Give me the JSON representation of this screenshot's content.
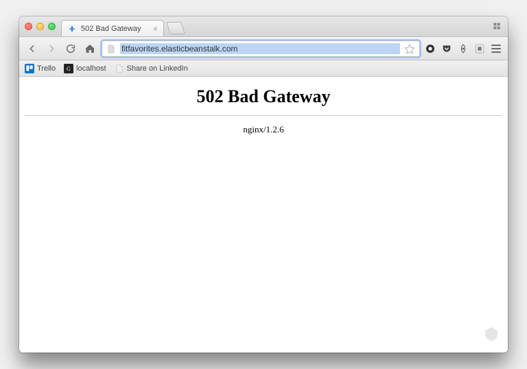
{
  "tab": {
    "title": "502 Bad Gateway"
  },
  "address": {
    "url": "fitfavorites.elasticbeanstalk.com"
  },
  "bookmarks": [
    {
      "label": "Trello"
    },
    {
      "label": "localhost"
    },
    {
      "label": "Share on LinkedIn"
    }
  ],
  "page": {
    "heading": "502 Bad Gateway",
    "server": "nginx/1.2.6"
  }
}
